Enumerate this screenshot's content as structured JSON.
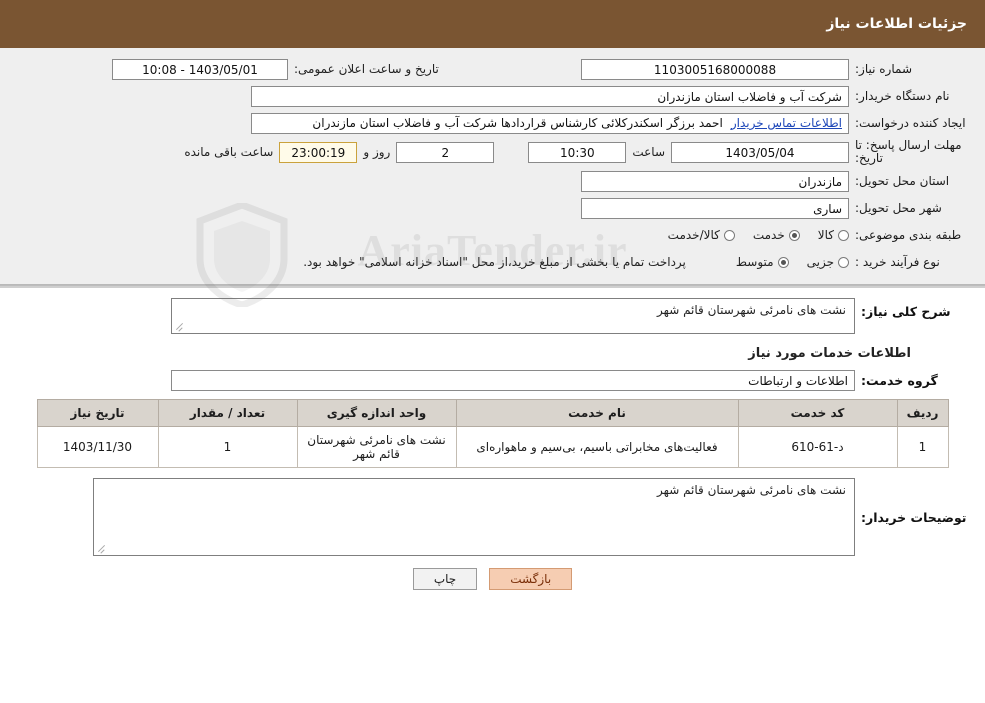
{
  "header": {
    "title": "جزئیات اطلاعات نیاز"
  },
  "form": {
    "need_number_label": "شماره نیاز:",
    "need_number_value": "1103005168000088",
    "announce_datetime_label": "تاریخ و ساعت اعلان عمومی:",
    "announce_datetime_value": "1403/05/01 - 10:08",
    "buyer_org_label": "نام دستگاه خریدار:",
    "buyer_org_value": "شرکت آب و فاضلاب استان مازندران",
    "requester_label": "ایجاد کننده درخواست:",
    "requester_value": "احمد برزگر اسکندرکلائی کارشناس قراردادها شرکت آب و فاضلاب استان مازندران",
    "contact_link": "اطلاعات تماس خریدار",
    "deadline_label": "مهلت ارسال پاسخ: تا تاریخ:",
    "deadline_date": "1403/05/04",
    "hour_label": "ساعت",
    "deadline_time": "10:30",
    "days_value": "2",
    "days_label": "روز و",
    "remaining_time": "23:00:19",
    "remaining_label": "ساعت باقی مانده",
    "province_label": "استان محل تحویل:",
    "province_value": "مازندران",
    "city_label": "شهر محل تحویل:",
    "city_value": "ساری",
    "category_label": "طبقه بندی موضوعی:",
    "category_options": [
      {
        "label": "کالا",
        "selected": false
      },
      {
        "label": "خدمت",
        "selected": true
      },
      {
        "label": "کالا/خدمت",
        "selected": false
      }
    ],
    "process_label": "نوع فرآیند خرید :",
    "process_options": [
      {
        "label": "جزیی",
        "selected": false
      },
      {
        "label": "متوسط",
        "selected": true
      }
    ],
    "process_note": "پرداخت تمام یا بخشی از مبلغ خرید،از محل \"اسناد خزانه اسلامی\" خواهد بود."
  },
  "summary": {
    "label": "شرح کلی نیاز:",
    "value": "نشت های نامرئی شهرستان قائم شهر"
  },
  "services": {
    "section_title": "اطلاعات خدمات مورد نیاز",
    "group_label": "گروه خدمت:",
    "group_value": "اطلاعات و ارتباطات",
    "table": {
      "columns": [
        "ردیف",
        "کد خدمت",
        "نام خدمت",
        "واحد اندازه گیری",
        "تعداد / مقدار",
        "تاریخ نیاز"
      ],
      "rows": [
        {
          "row": "1",
          "code": "د-61-610",
          "name": "فعالیت‌های مخابراتی باسیم، بی‌سیم و ماهواره‌ای",
          "unit": "نشت های نامرئی شهرستان قائم شهر",
          "qty": "1",
          "date": "1403/11/30"
        }
      ]
    }
  },
  "buyer_notes": {
    "label": "توضیحات خریدار:",
    "value": "نشت های نامرئی شهرستان قائم شهر"
  },
  "footer": {
    "print_label": "چاپ",
    "back_label": "بازگشت"
  },
  "watermark": {
    "text": "AriaTender.ir"
  }
}
